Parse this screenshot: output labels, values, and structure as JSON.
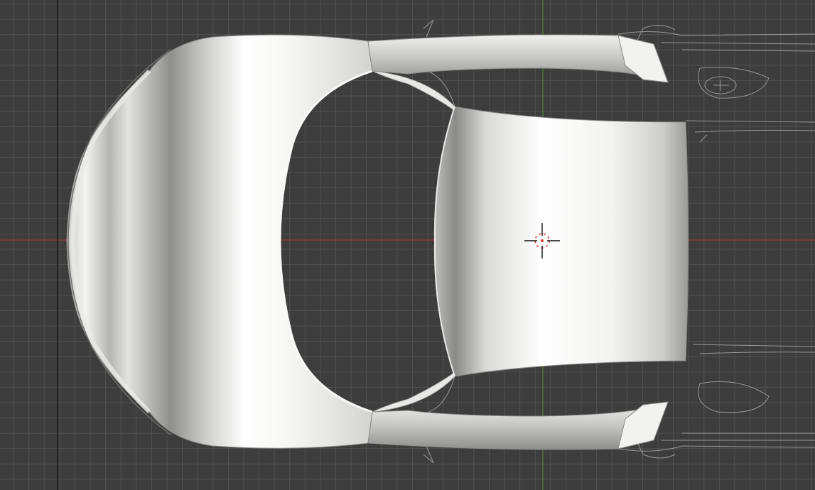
{
  "viewport": {
    "grid_color": "#515151",
    "background_color": "#3d3d3d",
    "x_axis_color": "#a03c3c",
    "y_axis_color": "#5e8a3a",
    "reference_line_color": "#161616"
  },
  "model": {
    "body_color": "#d9d9d7",
    "highlight_color": "#ffffff",
    "shadow_color": "#8e8e8c",
    "blueprint_line_color": "#b5b5b5"
  },
  "cursor": {
    "icon": "3d-cursor-icon",
    "ring_color_a": "#d43c2c",
    "ring_color_b": "#ffffff"
  }
}
